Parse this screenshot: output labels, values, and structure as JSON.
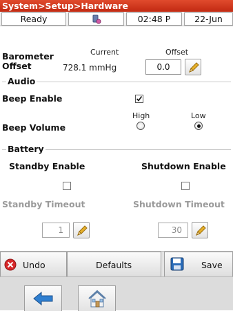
{
  "title": "System>Setup>Hardware",
  "status": {
    "state": "Ready",
    "icon": "sensor-icon",
    "time": "02:48 P",
    "date": "22-Jun"
  },
  "barometer": {
    "label_line1": "Barometer",
    "label_line2": "Offset",
    "current_header": "Current",
    "offset_header": "Offset",
    "current_value": "728.1 mmHg",
    "offset_value": "0.0"
  },
  "audio": {
    "legend": "Audio",
    "beep_enable_label": "Beep Enable",
    "beep_enable_checked": true,
    "beep_volume_label": "Beep Volume",
    "high_label": "High",
    "low_label": "Low",
    "selected_volume": "Low"
  },
  "battery": {
    "legend": "Battery",
    "standby_enable_label": "Standby Enable",
    "shutdown_enable_label": "Shutdown Enable",
    "standby_enable_checked": false,
    "shutdown_enable_checked": false,
    "standby_timeout_label": "Standby Timeout",
    "shutdown_timeout_label": "Shutdown Timeout",
    "standby_timeout_value": "1",
    "shutdown_timeout_value": "30"
  },
  "toolbar": {
    "undo_label": "Undo",
    "defaults_label": "Defaults",
    "save_label": "Save"
  },
  "colors": {
    "title_bar": "#d43a1f",
    "undo_icon": "#d8282a",
    "back_arrow": "#2f7fd0",
    "pencil": "#e0a820"
  }
}
